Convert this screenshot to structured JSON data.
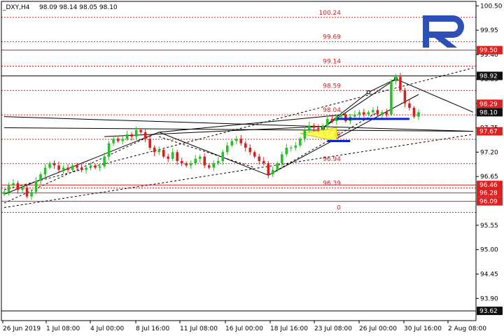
{
  "header": {
    "symbol": "_DXY,H4",
    "ohlc": "98.09 98.14 98.05 98.10"
  },
  "colors": {
    "bull": "#22c322",
    "bear": "#e01b1b",
    "level": "#e02020",
    "fib": "#d21f1f",
    "channel": "#000000",
    "highlight": "#ffff33",
    "marker": "#0a22c9",
    "logo": "#2d4fb8"
  },
  "logo_icon": "roboforex-r-logo",
  "chart_data": {
    "type": "candlestick",
    "title": "",
    "ylim": [
      93.4,
      100.6
    ],
    "y_ticks": [
      "100.50",
      "99.95",
      "99.40",
      "98.85",
      "98.30",
      "97.75",
      "97.20",
      "96.65",
      "95.55",
      "95.00",
      "94.45",
      "93.90"
    ],
    "x_ticks": [
      "26 Jun 2019",
      "1 Jul 08:00",
      "4 Jul 00:00",
      "8 Jul 16:00",
      "11 Jul 08:00",
      "16 Jul 00:00",
      "18 Jul 16:00",
      "23 Jul 08:00",
      "26 Jul 00:00",
      "30 Jul 16:00",
      "2 Aug 08:00"
    ],
    "price_badges": [
      {
        "label": "99.50",
        "value": 99.5,
        "style": "red"
      },
      {
        "label": "98.92",
        "value": 98.92,
        "style": "dark"
      },
      {
        "label": "98.29",
        "value": 98.29,
        "style": "red"
      },
      {
        "label": "98.10",
        "value": 98.1,
        "style": "dark"
      },
      {
        "label": "97.67",
        "value": 97.67,
        "style": "red"
      },
      {
        "label": "96.46",
        "value": 96.46,
        "style": "red"
      },
      {
        "label": "96.28",
        "value": 96.28,
        "style": "red"
      },
      {
        "label": "96.09",
        "value": 96.09,
        "style": "red"
      },
      {
        "label": "93.62",
        "value": 93.62,
        "style": "dark"
      }
    ],
    "horizontal_lines": [
      {
        "value": 99.5,
        "style": "solid-red"
      },
      {
        "value": 98.92,
        "style": "solid-black"
      },
      {
        "value": 96.46,
        "style": "solid-red"
      },
      {
        "value": 96.28,
        "style": "solid-red"
      },
      {
        "value": 96.09,
        "style": "solid-red"
      },
      {
        "value": 93.62,
        "style": "solid-black"
      }
    ],
    "fib_levels": [
      {
        "label": "100.24",
        "value": 100.24
      },
      {
        "label": "99.69",
        "value": 99.69
      },
      {
        "label": "99.14",
        "value": 99.14
      },
      {
        "label": "98.59",
        "value": 98.59
      },
      {
        "label": "98.04",
        "value": 98.04
      },
      {
        "label": "97.49",
        "value": 97.49
      },
      {
        "label": "96.94",
        "value": 96.94
      },
      {
        "label": "96.39",
        "value": 96.39
      },
      {
        "label": "0",
        "value": 95.84
      }
    ],
    "closes": [
      96.3,
      96.45,
      96.5,
      96.35,
      96.4,
      96.2,
      96.3,
      96.55,
      96.7,
      96.85,
      96.95,
      96.9,
      96.8,
      96.85,
      96.8,
      96.9,
      96.85,
      96.8,
      96.85,
      96.9,
      96.85,
      96.88,
      97.1,
      97.4,
      97.5,
      97.45,
      97.5,
      97.6,
      97.55,
      97.7,
      97.65,
      97.5,
      97.3,
      97.2,
      97.25,
      97.1,
      97.05,
      97.2,
      97.0,
      96.95,
      96.9,
      96.95,
      97.05,
      97.1,
      96.9,
      96.85,
      96.95,
      97.0,
      97.2,
      97.35,
      97.45,
      97.5,
      97.4,
      97.3,
      97.2,
      97.1,
      97.0,
      96.95,
      96.7,
      96.8,
      96.95,
      97.15,
      97.3,
      97.3,
      97.35,
      97.5,
      97.7,
      97.8,
      97.75,
      97.72,
      97.8,
      97.95,
      97.9,
      98.0,
      98.05,
      97.9,
      98.0,
      98.05,
      98.1,
      98.05,
      98.1,
      98.15,
      98.05,
      98.1,
      98.05,
      98.8,
      98.9,
      98.6,
      98.3,
      98.2,
      98.0,
      98.1
    ],
    "trend_lines": [
      {
        "from": [
          0,
          96.25
        ],
        "to": [
          34,
          97.65
        ],
        "style": "solid"
      },
      {
        "from": [
          34,
          97.65
        ],
        "to": [
          55,
          96.8
        ],
        "style": "solid"
      },
      {
        "from": [
          55,
          96.8
        ],
        "to": [
          58,
          96.68
        ],
        "style": "solid"
      },
      {
        "from": [
          58,
          96.68
        ],
        "to": [
          91,
          98.5
        ],
        "style": "solid"
      },
      {
        "from": [
          22,
          97.55
        ],
        "to": [
          70,
          97.78
        ],
        "style": "solid"
      },
      {
        "from": [
          34,
          97.65
        ],
        "to": [
          75,
          98.05
        ],
        "style": "solid"
      },
      {
        "from": [
          0,
          98.0
        ],
        "to": [
          103,
          97.67
        ],
        "style": "solid"
      },
      {
        "from": [
          0,
          97.75
        ],
        "to": [
          103,
          97.67
        ],
        "style": "solid"
      },
      {
        "from": [
          70,
          97.75
        ],
        "to": [
          86,
          98.85
        ],
        "style": "solid"
      },
      {
        "from": [
          86,
          98.85
        ],
        "to": [
          103,
          98.1
        ],
        "style": "solid"
      },
      {
        "from": [
          0,
          96.35
        ],
        "to": [
          103,
          99.1
        ],
        "style": "dashed"
      },
      {
        "from": [
          0,
          95.95
        ],
        "to": [
          103,
          97.6
        ],
        "style": "dashed"
      },
      {
        "from": [
          0,
          96.05
        ],
        "to": [
          34,
          97.65
        ],
        "style": "dashed"
      },
      {
        "from": [
          34,
          97.55
        ],
        "to": [
          55,
          96.85
        ],
        "style": "dashed"
      },
      {
        "from": [
          58,
          96.68
        ],
        "to": [
          82,
          98.1
        ],
        "style": "dashed"
      }
    ],
    "highlight_box": {
      "from": [
        65,
        97.5
      ],
      "to": [
        73,
        97.75
      ]
    },
    "projection": {
      "points": [
        [
          70,
          97.75
        ],
        [
          80,
          98.55
        ],
        [
          86,
          98.85
        ]
      ]
    },
    "markers": [
      {
        "from": [
          73,
          97.95
        ],
        "to": [
          89,
          97.95
        ]
      },
      {
        "from": [
          71,
          97.45
        ],
        "to": [
          76,
          97.45
        ]
      }
    ],
    "grid": false,
    "legend": "none"
  }
}
